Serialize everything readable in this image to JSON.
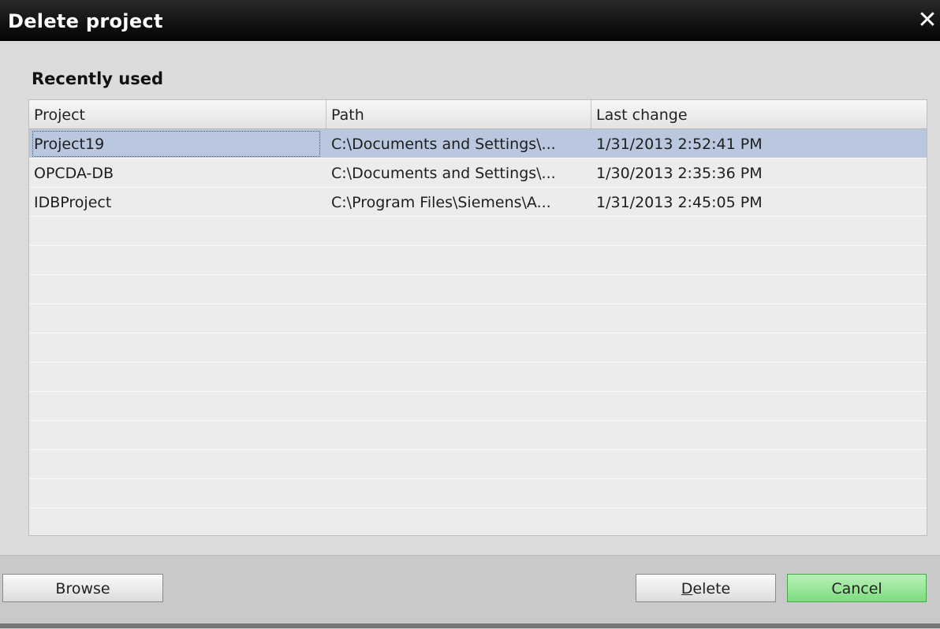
{
  "window": {
    "title": "Delete project",
    "close_label": "✕"
  },
  "section_title": "Recently used",
  "table": {
    "columns": [
      "Project",
      "Path",
      "Last change"
    ],
    "rows": [
      {
        "project": "Project19",
        "path": "C:\\Documents and Settings\\...",
        "last_change": "1/31/2013 2:52:41 PM",
        "selected": true
      },
      {
        "project": "OPCDA-DB",
        "path": "C:\\Documents and Settings\\...",
        "last_change": "1/30/2013 2:35:36 PM",
        "selected": false
      },
      {
        "project": "IDBProject",
        "path": "C:\\Program Files\\Siemens\\A...",
        "last_change": "1/31/2013 2:45:05 PM",
        "selected": false
      }
    ]
  },
  "buttons": {
    "browse": "Browse",
    "delete_mnemonic": "D",
    "delete_rest": "elete",
    "cancel": "Cancel"
  },
  "colors": {
    "selected_row": "#b9c8df",
    "cancel_button": "#8fe08f",
    "titlebar": "#111111"
  }
}
